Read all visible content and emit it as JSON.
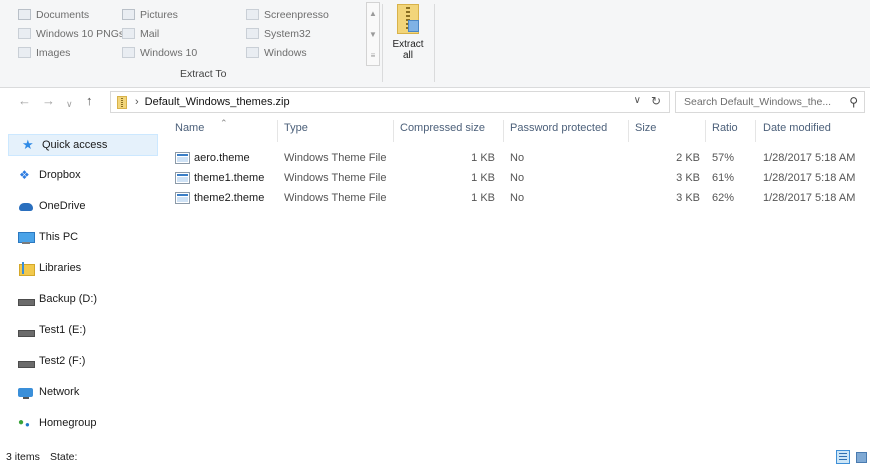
{
  "ribbon": {
    "items_col1": [
      "Documents",
      "Windows 10 PNGs",
      "Images"
    ],
    "items_col2": [
      "Pictures",
      "Mail",
      "Windows 10"
    ],
    "items_col3": [
      "Screenpresso",
      "System32",
      "Windows"
    ],
    "group_label": "Extract To",
    "extract_all_label_line1": "Extract",
    "extract_all_label_line2": "all"
  },
  "address": {
    "path": "Default_Windows_themes.zip",
    "search_placeholder": "Search Default_Windows_the..."
  },
  "nav": {
    "items": [
      {
        "label": "Quick access",
        "icon": "star-icon",
        "selected": true
      },
      {
        "label": "Dropbox",
        "icon": "dropbox-icon"
      },
      {
        "label": "OneDrive",
        "icon": "onedrive-icon"
      },
      {
        "label": "This PC",
        "icon": "this-pc-icon"
      },
      {
        "label": "Libraries",
        "icon": "libraries-icon"
      },
      {
        "label": "Backup (D:)",
        "icon": "drive-icon"
      },
      {
        "label": "Test1 (E:)",
        "icon": "drive-icon"
      },
      {
        "label": "Test2 (F:)",
        "icon": "drive-icon"
      },
      {
        "label": "Network",
        "icon": "network-icon"
      },
      {
        "label": "Homegroup",
        "icon": "homegroup-icon"
      }
    ]
  },
  "columns": [
    "Name",
    "Type",
    "Compressed size",
    "Password protected",
    "Size",
    "Ratio",
    "Date modified"
  ],
  "files": [
    {
      "name": "aero.theme",
      "type": "Windows Theme File",
      "compressed": "1 KB",
      "password": "No",
      "size": "2 KB",
      "ratio": "57%",
      "date": "1/28/2017 5:18 AM"
    },
    {
      "name": "theme1.theme",
      "type": "Windows Theme File",
      "compressed": "1 KB",
      "password": "No",
      "size": "3 KB",
      "ratio": "61%",
      "date": "1/28/2017 5:18 AM"
    },
    {
      "name": "theme2.theme",
      "type": "Windows Theme File",
      "compressed": "1 KB",
      "password": "No",
      "size": "3 KB",
      "ratio": "62%",
      "date": "1/28/2017 5:18 AM"
    }
  ],
  "status": {
    "items_count": "3 items",
    "state_label": "State:"
  }
}
